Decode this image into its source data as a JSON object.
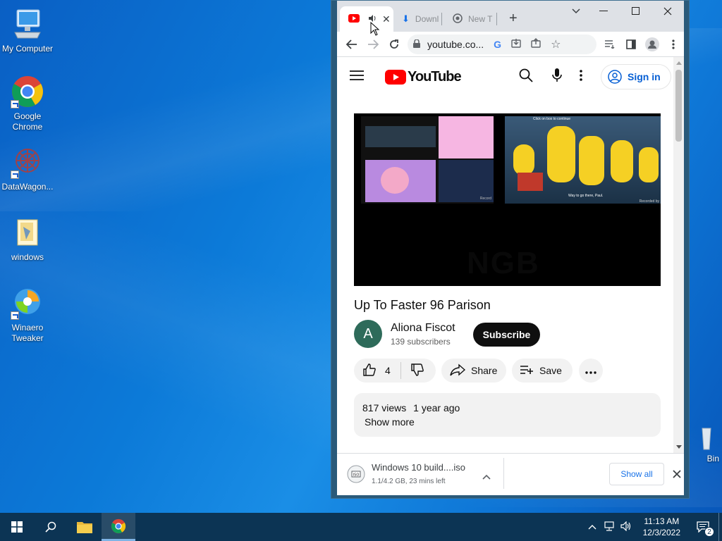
{
  "desktop": {
    "icons": [
      {
        "label": "My Computer"
      },
      {
        "label": "Google Chrome"
      },
      {
        "label": "DataWagon..."
      },
      {
        "label": "windows"
      },
      {
        "label": "Winaero Tweaker"
      },
      {
        "label": "Bin"
      }
    ]
  },
  "taskbar": {
    "time": "11:13 AM",
    "date": "12/3/2022",
    "notification_count": "2"
  },
  "browser": {
    "tabs": [
      {
        "label": "",
        "active": true
      },
      {
        "label": "Downl"
      },
      {
        "label": "New T"
      }
    ],
    "url": "youtube.co...",
    "page": {
      "header": {
        "logo": "YouTube",
        "sign_in": "Sign in"
      },
      "video": {
        "title": "Up To Faster 96 Parison",
        "channel": "Aliona Fiscot",
        "avatar_letter": "A",
        "subscribers": "139 subscribers",
        "subscribe_label": "Subscribe",
        "likes": "4",
        "share_label": "Share",
        "save_label": "Save",
        "views": "817 views",
        "age": "1 year ago",
        "show_more": "Show more",
        "overlay_text": "NGB",
        "thumb_caption_1": "Click on box to continue",
        "thumb_caption_2": "Way to go there, Paul.",
        "thumb_recorded": "Recorded by",
        "thumb_record_small": "Record"
      }
    },
    "download": {
      "filename": "Windows 10 build....iso",
      "status": "1.1/4.2 GB, 23 mins left",
      "show_all": "Show all"
    }
  }
}
